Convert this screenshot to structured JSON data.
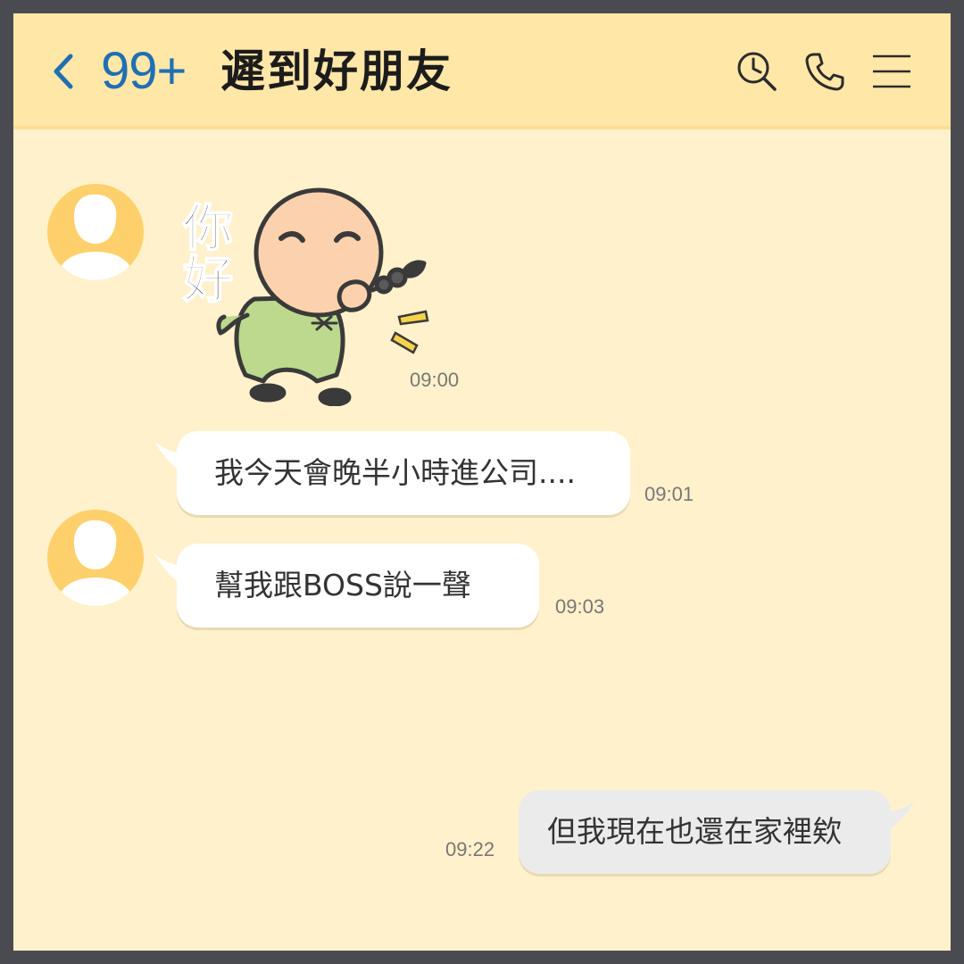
{
  "header": {
    "back_icon": "chevron-left-icon",
    "unread_count": "99+",
    "title": "遲到好朋友",
    "icons": [
      "search-history-icon",
      "phone-icon",
      "menu-icon"
    ],
    "accent_color": "#1f6fb4",
    "background_color": "#ffe7a8"
  },
  "conversation": {
    "background_color": "#fff1cc",
    "messages": [
      {
        "type": "sticker",
        "sticker_text": "你好",
        "sender": "incoming",
        "time": "09:00"
      },
      {
        "type": "text",
        "sender": "incoming",
        "text": "我今天會晚半小時進公司....",
        "time": "09:01"
      },
      {
        "type": "text",
        "sender": "incoming",
        "text": "幫我跟BOSS說一聲",
        "time": "09:03"
      },
      {
        "type": "text",
        "sender": "outgoing",
        "text": "但我現在也還在家裡欸",
        "time": "09:22"
      }
    ]
  }
}
